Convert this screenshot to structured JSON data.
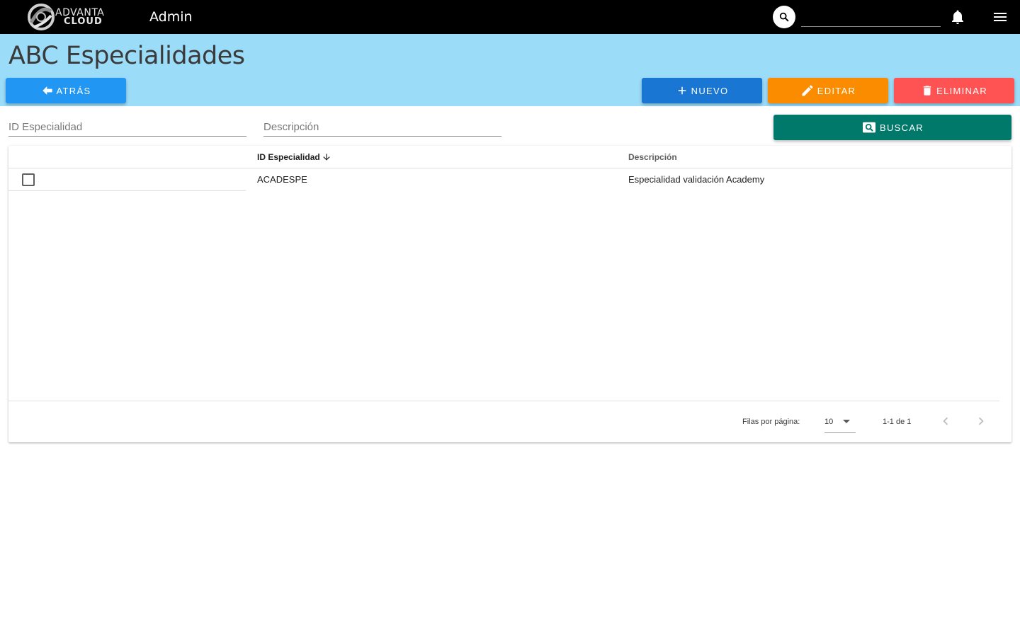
{
  "topbar": {
    "logo_line1": "ADVANTA",
    "logo_line2": "CLOUD",
    "app_title": "Admin",
    "search_value": "",
    "icons": [
      "search-icon",
      "bell-icon",
      "menu-icon"
    ]
  },
  "page": {
    "title": "ABC Especialidades"
  },
  "toolbar": {
    "back_label": "ATRÁS",
    "new_label": "NUEVO",
    "edit_label": "EDITAR",
    "delete_label": "ELIMINAR",
    "search_label": "BUSCAR"
  },
  "filters": {
    "id_placeholder": "ID Especialidad",
    "id_value": "",
    "desc_placeholder": "Descripción",
    "desc_value": ""
  },
  "table": {
    "columns": [
      "ID Especialidad",
      "Descripción"
    ],
    "rows": [
      {
        "id": "ACADESPE",
        "descripcion": "Especialidad validación Academy",
        "checked": false
      }
    ],
    "footer": {
      "rows_per_page_label": "Filas por página:",
      "rows_per_page_value": "10",
      "range": "1-1 de 1"
    }
  },
  "colors": {
    "topbar": "#000000",
    "header_band": "#9bdcf9",
    "back": "#2196f3",
    "new": "#1976d2",
    "edit": "#fb8c00",
    "delete": "#ff5252",
    "search": "#00796b"
  }
}
